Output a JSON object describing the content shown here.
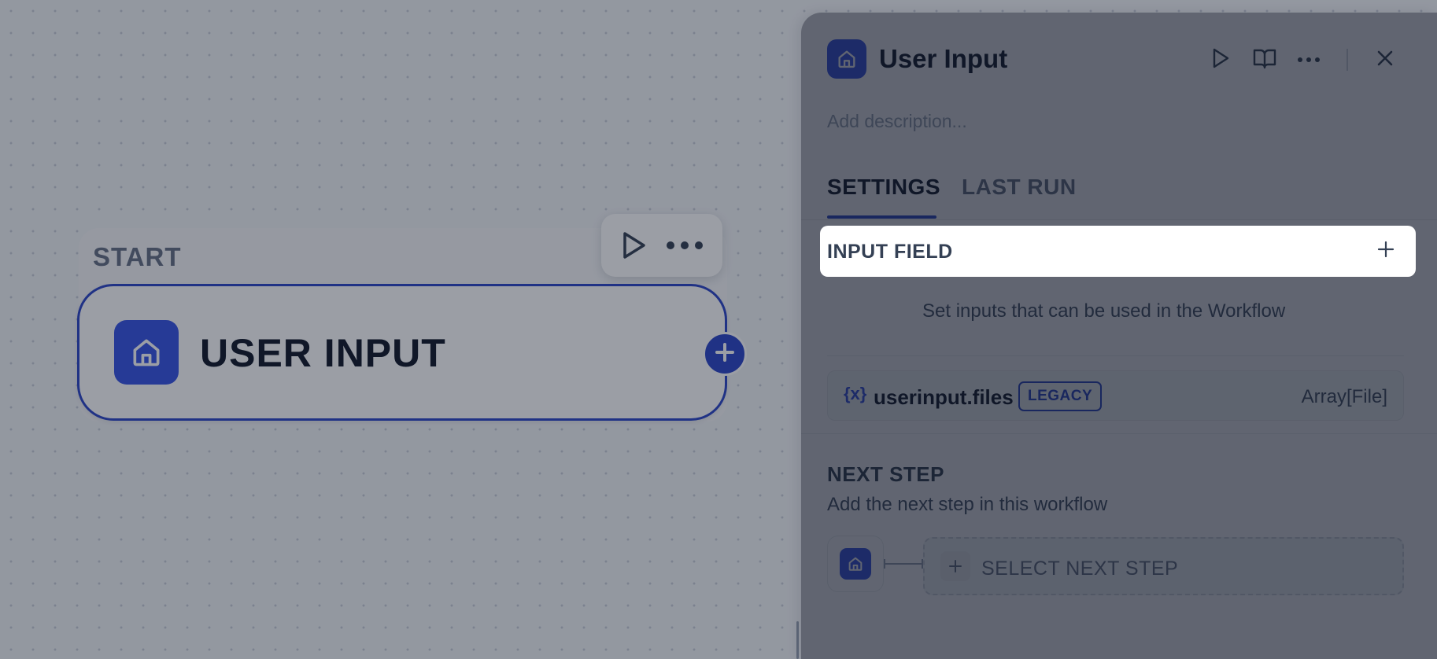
{
  "canvas": {
    "node": {
      "group_label": "START",
      "title": "USER INPUT",
      "icon": "home-icon",
      "toolbar": {
        "run_icon": "play-icon",
        "more_icon": "more-icon"
      },
      "add_icon": "plus-icon"
    }
  },
  "panel": {
    "title": "User Input",
    "icon": "home-icon",
    "header_actions": [
      "play-icon",
      "book-open-icon",
      "more-icon",
      "close-icon"
    ],
    "description_placeholder": "Add description...",
    "tabs": [
      {
        "label": "SETTINGS",
        "active": true
      },
      {
        "label": "LAST RUN",
        "active": false
      }
    ],
    "input_field": {
      "label": "INPUT FIELD",
      "hint": "Set inputs that can be used in the Workflow",
      "variables": [
        {
          "icon": "{x}",
          "name": "userinput.files",
          "badge": "LEGACY",
          "type": "Array[File]"
        }
      ]
    },
    "next_step": {
      "title": "NEXT STEP",
      "description": "Add the next step in this workflow",
      "select_label": "SELECT NEXT STEP"
    }
  },
  "colors": {
    "accent": "#2b45c9",
    "icon_bg": "#3653e6",
    "overlay": "rgba(16,24,40,0.42)"
  }
}
